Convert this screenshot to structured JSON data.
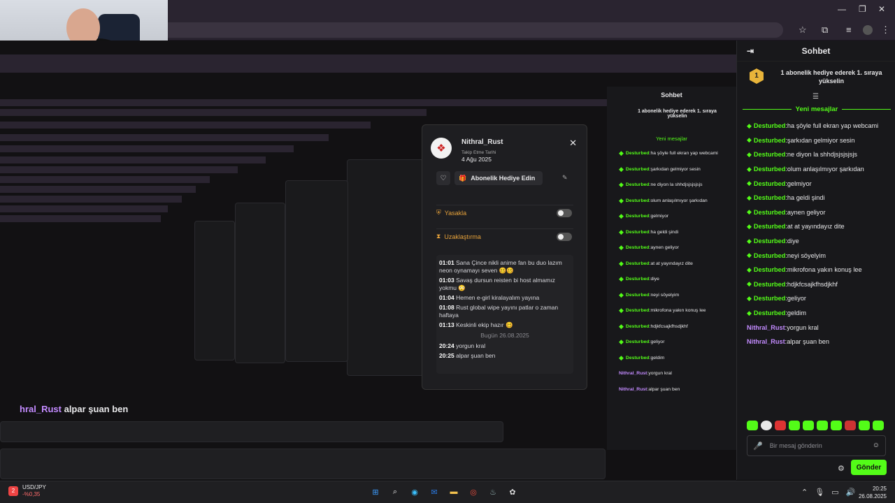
{
  "window": {
    "min": "—",
    "max": "❐",
    "close": "✕"
  },
  "toolbar": {
    "star": "☆",
    "ext": "⧉",
    "media": "≡",
    "menu": "⋮"
  },
  "popup": {
    "username": "Nithral_Rust",
    "follow_label": "Takip Etme Tarihi",
    "follow_date": "4 Ağu 2025",
    "gift_label": "Abonelik Hediye Edin",
    "ban_label": "Yasakla",
    "timeout_label": "Uzaklaştırma",
    "log": [
      {
        "time": "01:01",
        "text": "Sana Çince nikli anime fan bu duo lazım neon oynamayı seven 🥴🥴"
      },
      {
        "time": "01:03",
        "text": "Savaş dursun reisten bi host almamız yokmu 😳"
      },
      {
        "time": "01:04",
        "text": "Hemen e-girl kiralayalım yayına"
      },
      {
        "time": "01:08",
        "text": "Rust global wipe yayını patlar o zaman haftaya"
      },
      {
        "time": "01:13",
        "text": "Keskinli ekip hazır 🥴"
      }
    ],
    "date_separator": "Bugün 26.08.2025",
    "log_today": [
      {
        "time": "20:24",
        "text": "yorgun kral"
      },
      {
        "time": "20:25",
        "text": "alpar şuan ben"
      }
    ]
  },
  "chat": {
    "title": "Sohbet",
    "pinned_rank": "1",
    "pinned_text": "1 abonelik hediye ederek 1. sıraya yükselin",
    "new_messages_label": "Yeni mesajlar",
    "messages": [
      {
        "user": "Desturbed",
        "text": "ha şöyle full ekran yap webcami",
        "type": "sub"
      },
      {
        "user": "Desturbed",
        "text": "şarkıdan gelmiyor sesin",
        "type": "sub"
      },
      {
        "user": "Desturbed",
        "text": "ne diyon la shhdjsjsjsjsjs",
        "type": "sub"
      },
      {
        "user": "Desturbed",
        "text": "olum anlaşılmıyor şarkıdan",
        "type": "sub"
      },
      {
        "user": "Desturbed",
        "text": "gelmiyor",
        "type": "sub"
      },
      {
        "user": "Desturbed",
        "text": "ha geldi şindi",
        "type": "sub"
      },
      {
        "user": "Desturbed",
        "text": "aynen geliyor",
        "type": "sub"
      },
      {
        "user": "Desturbed",
        "text": "at at yayındayız dite",
        "type": "sub"
      },
      {
        "user": "Desturbed",
        "text": "diye",
        "type": "sub"
      },
      {
        "user": "Desturbed",
        "text": "neyi söyelyim",
        "type": "sub"
      },
      {
        "user": "Desturbed",
        "text": "mikrofona yakın konuş lee",
        "type": "sub"
      },
      {
        "user": "Desturbed",
        "text": "hdjkfcsajkfhsdjkhf",
        "type": "sub"
      },
      {
        "user": "Desturbed",
        "text": "geliyor",
        "type": "sub"
      },
      {
        "user": "Desturbed",
        "text": "geldim",
        "type": "sub"
      },
      {
        "user": "Nithral_Rust",
        "text": "yorgun kral",
        "type": "plain"
      },
      {
        "user": "Nithral_Rust",
        "text": "alpar şuan ben",
        "type": "plain"
      }
    ],
    "input_placeholder": "Bir mesaj gönderin",
    "send_label": "Gönder"
  },
  "overlay": {
    "user": "hral_Rust",
    "text": "alpar şuan ben"
  },
  "taskbar": {
    "ticker_symbol": "USD/JPY",
    "ticker_change": "-%0,35",
    "ticker_badge": "2",
    "time": "20:25",
    "date": "26.08.2025"
  },
  "colors": {
    "accent": "#53fc18",
    "purple_user": "#c38bff",
    "gold": "#e8b43a"
  }
}
